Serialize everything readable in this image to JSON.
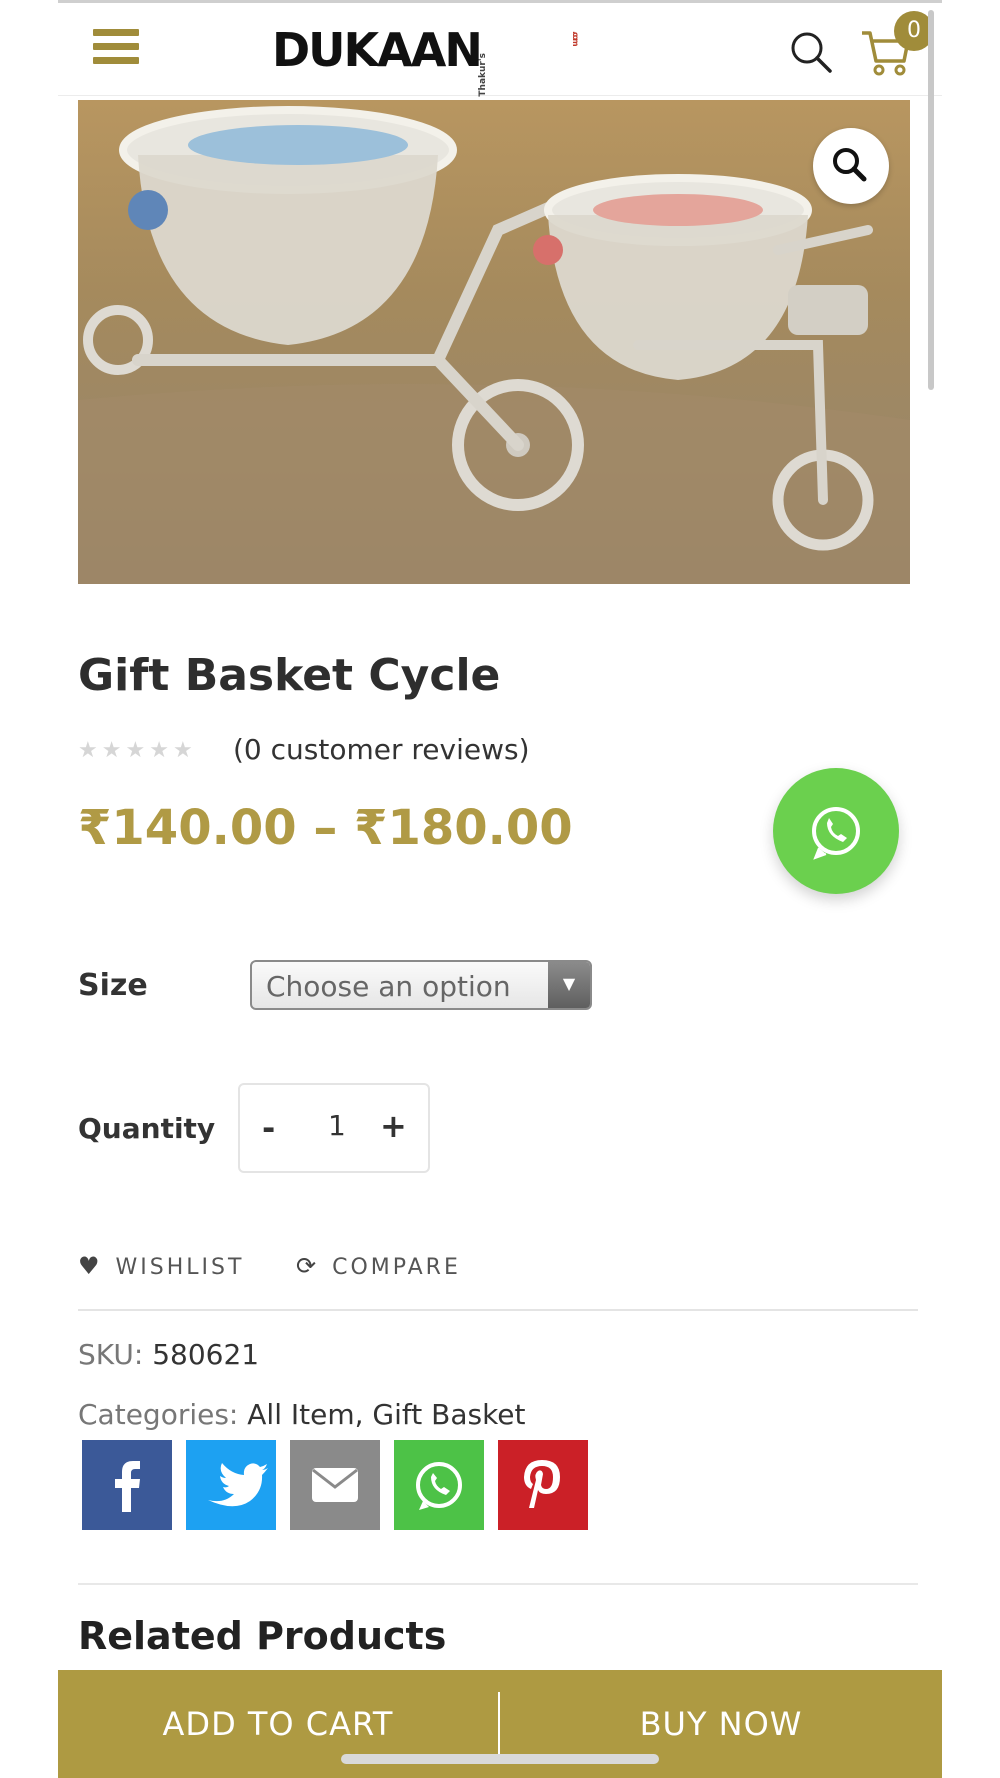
{
  "header": {
    "logo_text": "DUKAAN",
    "logo_prefix": "Thakur's",
    "logo_suffix": ".com",
    "cart_count": "0",
    "menu_icon": "hamburger-menu-icon",
    "search_icon": "search-icon",
    "cart_icon": "cart-icon"
  },
  "product": {
    "title": "Gift Basket Cycle",
    "rating_stars": 0,
    "reviews_text": "(0 customer reviews)",
    "price_range": "₹140.00 – ₹180.00",
    "size_label": "Size",
    "size_placeholder": "Choose an option",
    "quantity_label": "Quantity",
    "quantity_minus": "-",
    "quantity_value": "1",
    "quantity_plus": "+",
    "wishlist_label": "WISHLIST",
    "compare_label": "COMPARE",
    "sku_label": "SKU:",
    "sku_value": "580621",
    "categories_label": "Categories:",
    "categories_value": "All Item, Gift Basket"
  },
  "share": [
    {
      "name": "facebook",
      "color": "#3b5998"
    },
    {
      "name": "twitter",
      "color": "#1da1f2"
    },
    {
      "name": "email",
      "color": "#8a8a8a"
    },
    {
      "name": "whatsapp",
      "color": "#4dc247"
    },
    {
      "name": "pinterest",
      "color": "#cb2027"
    }
  ],
  "related_heading": "Related Products",
  "bottom_bar": {
    "add_to_cart": "ADD TO CART",
    "buy_now": "BUY NOW"
  },
  "colors": {
    "accent": "#ae9a42",
    "price": "#b09a45",
    "whatsapp_float": "#6bd04e"
  }
}
